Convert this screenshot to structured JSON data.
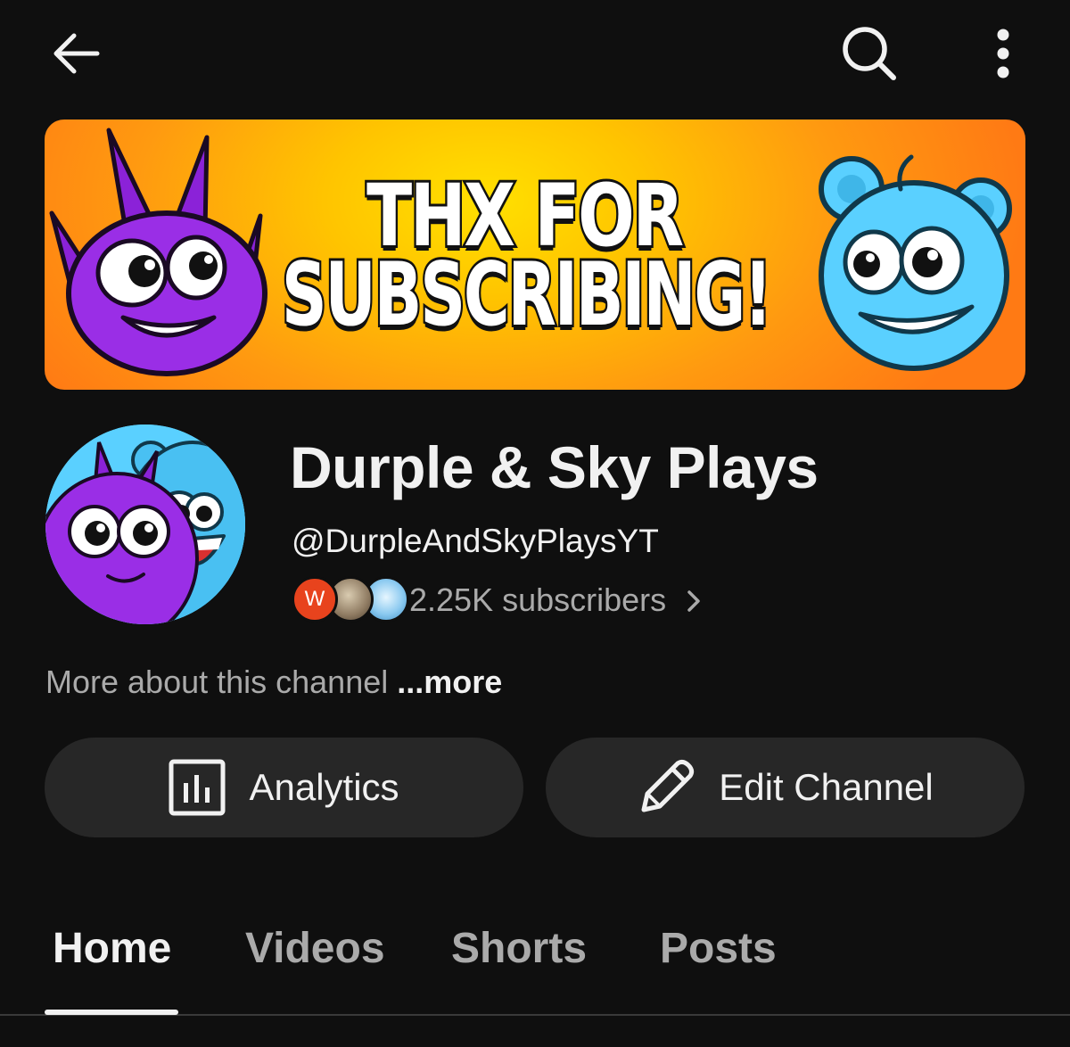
{
  "top_bar": {
    "back_icon": "arrow-left-icon",
    "search_icon": "search-icon",
    "more_icon": "more-vertical-icon"
  },
  "banner": {
    "line1": "THX FOR",
    "line2": "SUBSCRIBING!"
  },
  "channel": {
    "name": "Durple & Sky Plays",
    "handle": "@DurpleAndSkyPlaysYT",
    "subscriber_avatar_letter": "W",
    "subscribers": "2.25K subscribers",
    "about_text": "More about this channel",
    "about_more": "...more"
  },
  "actions": {
    "analytics_label": "Analytics",
    "analytics_icon": "bar-chart-icon",
    "edit_label": "Edit Channel",
    "edit_icon": "pencil-icon"
  },
  "tabs": [
    {
      "label": "Home",
      "active": true
    },
    {
      "label": "Videos",
      "active": false
    },
    {
      "label": "Shorts",
      "active": false
    },
    {
      "label": "Posts",
      "active": false
    }
  ],
  "colors": {
    "background": "#0f0f0f",
    "button_bg": "#272727",
    "text_primary": "#f1f1f1",
    "text_secondary": "#aaaaaa",
    "banner_orange": "#ff8a14",
    "banner_yellow": "#ffd400",
    "durple_purple": "#8a2be2",
    "sky_blue": "#5ad0ff"
  }
}
